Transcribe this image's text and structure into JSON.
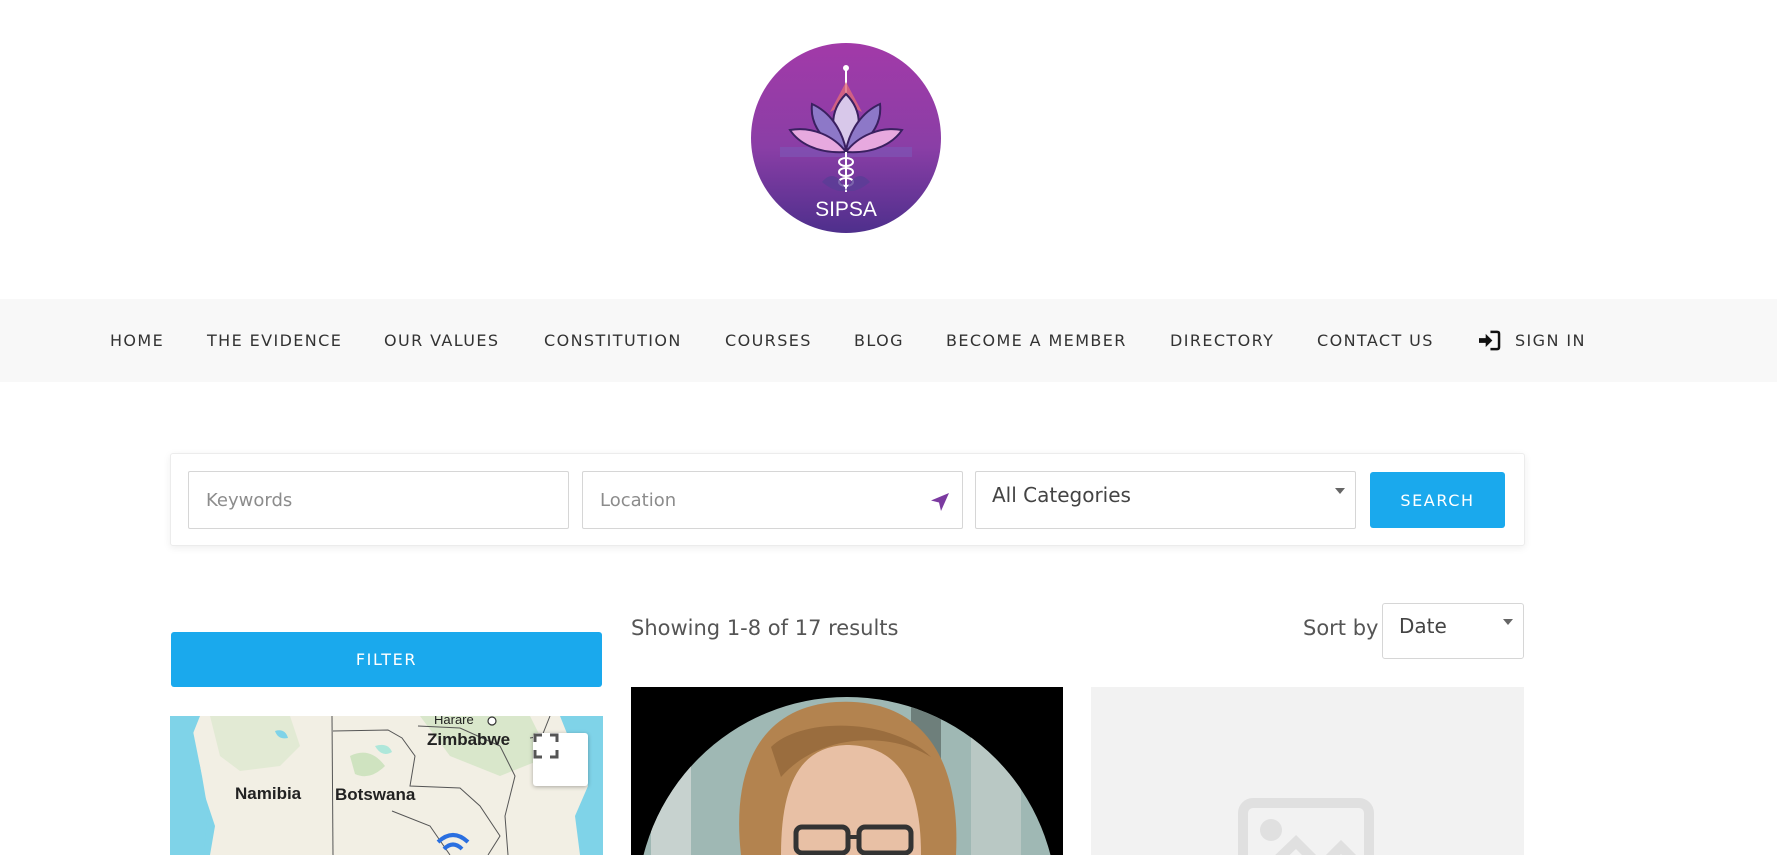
{
  "logo": {
    "text": "SIPSA"
  },
  "nav": {
    "items": [
      "HOME",
      "THE EVIDENCE",
      "OUR VALUES",
      "CONSTITUTION",
      "COURSES",
      "BLOG",
      "BECOME A MEMBER",
      "DIRECTORY",
      "CONTACT US"
    ],
    "signin": "SIGN IN"
  },
  "search": {
    "keywords_placeholder": "Keywords",
    "location_placeholder": "Location",
    "category_value": "All Categories",
    "button": "SEARCH"
  },
  "filter_button": "FILTER",
  "map": {
    "labels": [
      "Harare",
      "Zimbabwe",
      "Namibia",
      "Botswana"
    ]
  },
  "results": {
    "summary": "Showing 1-8 of 17 results",
    "sort_label": "Sort by",
    "sort_value": "Date"
  },
  "colors": {
    "accent": "#1aa9ed",
    "logo_purple": "#7b3aa0",
    "nav_bg": "#f8f8f8"
  },
  "icons": [
    "sign-in-icon",
    "location-arrow-icon",
    "fullscreen-icon",
    "image-placeholder-icon"
  ]
}
